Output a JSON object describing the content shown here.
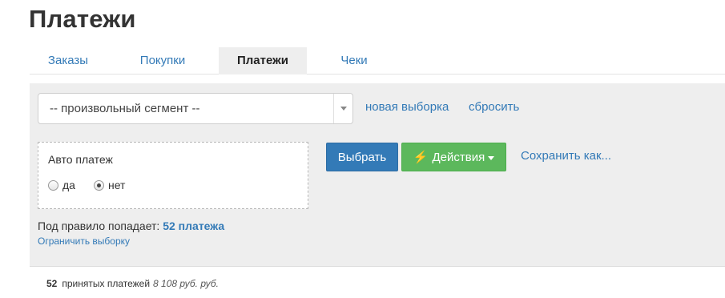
{
  "page": {
    "title": "Платежи"
  },
  "tabs": [
    {
      "label": "Заказы",
      "active": false
    },
    {
      "label": "Покупки",
      "active": false
    },
    {
      "label": "Платежи",
      "active": true
    },
    {
      "label": "Чеки",
      "active": false
    }
  ],
  "segment": {
    "selected": "-- произвольный сегмент --",
    "new_selection_link": "новая выборка",
    "reset_link": "сбросить"
  },
  "filter": {
    "title": "Авто платеж",
    "options": [
      {
        "label": "да",
        "checked": false
      },
      {
        "label": "нет",
        "checked": true
      }
    ]
  },
  "actions": {
    "select_label": "Выбрать",
    "actions_label": "Действия",
    "save_as_label": "Сохранить как...",
    "bolt_icon": "⚡"
  },
  "rule": {
    "prefix": "Под правило попадает:",
    "count": "52 платежа",
    "limit_link": "Ограничить выборку"
  },
  "summary": {
    "count": "52",
    "label": "принятых платежей",
    "amount": "8 108 руб. руб."
  },
  "colors": {
    "link": "#337ab7",
    "primary": "#337ab7",
    "success": "#5cb85c",
    "panel": "#eeeeee"
  }
}
